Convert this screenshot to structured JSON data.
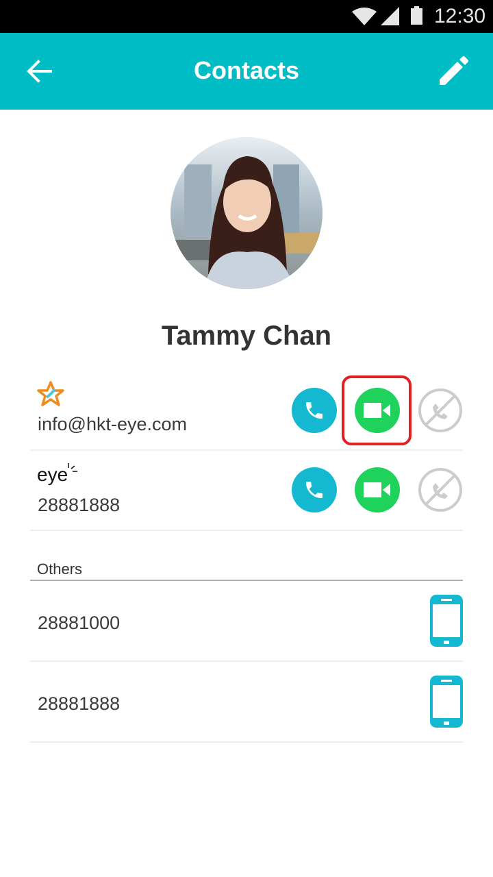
{
  "status_bar": {
    "time": "12:30",
    "icons": [
      "wifi-icon",
      "cellular-signal-icon",
      "battery-icon"
    ]
  },
  "app_bar": {
    "title": "Contacts",
    "back_icon": "arrow-back-icon",
    "edit_icon": "pencil-edit-icon"
  },
  "contact": {
    "name": "Tammy Chan",
    "avatar": "profile-photo"
  },
  "accounts": [
    {
      "service_icon": "star-logo-icon",
      "value": "info@hkt-eye.com",
      "actions": [
        "voice-call",
        "video-call",
        "call-disabled"
      ],
      "highlighted_action": "video-call"
    },
    {
      "service_icon": "eye-logo",
      "service_label": "eye",
      "value": "28881888",
      "actions": [
        "voice-call",
        "video-call",
        "call-disabled"
      ]
    }
  ],
  "others": {
    "label": "Others",
    "items": [
      {
        "value": "28881000",
        "icon": "mobile-phone-icon"
      },
      {
        "value": "28881888",
        "icon": "mobile-phone-icon"
      }
    ]
  },
  "colors": {
    "accent": "#00bcc5",
    "call": "#14b9d1",
    "video": "#1fd25c",
    "disabled": "#cccccc",
    "highlight": "#e11f26"
  }
}
